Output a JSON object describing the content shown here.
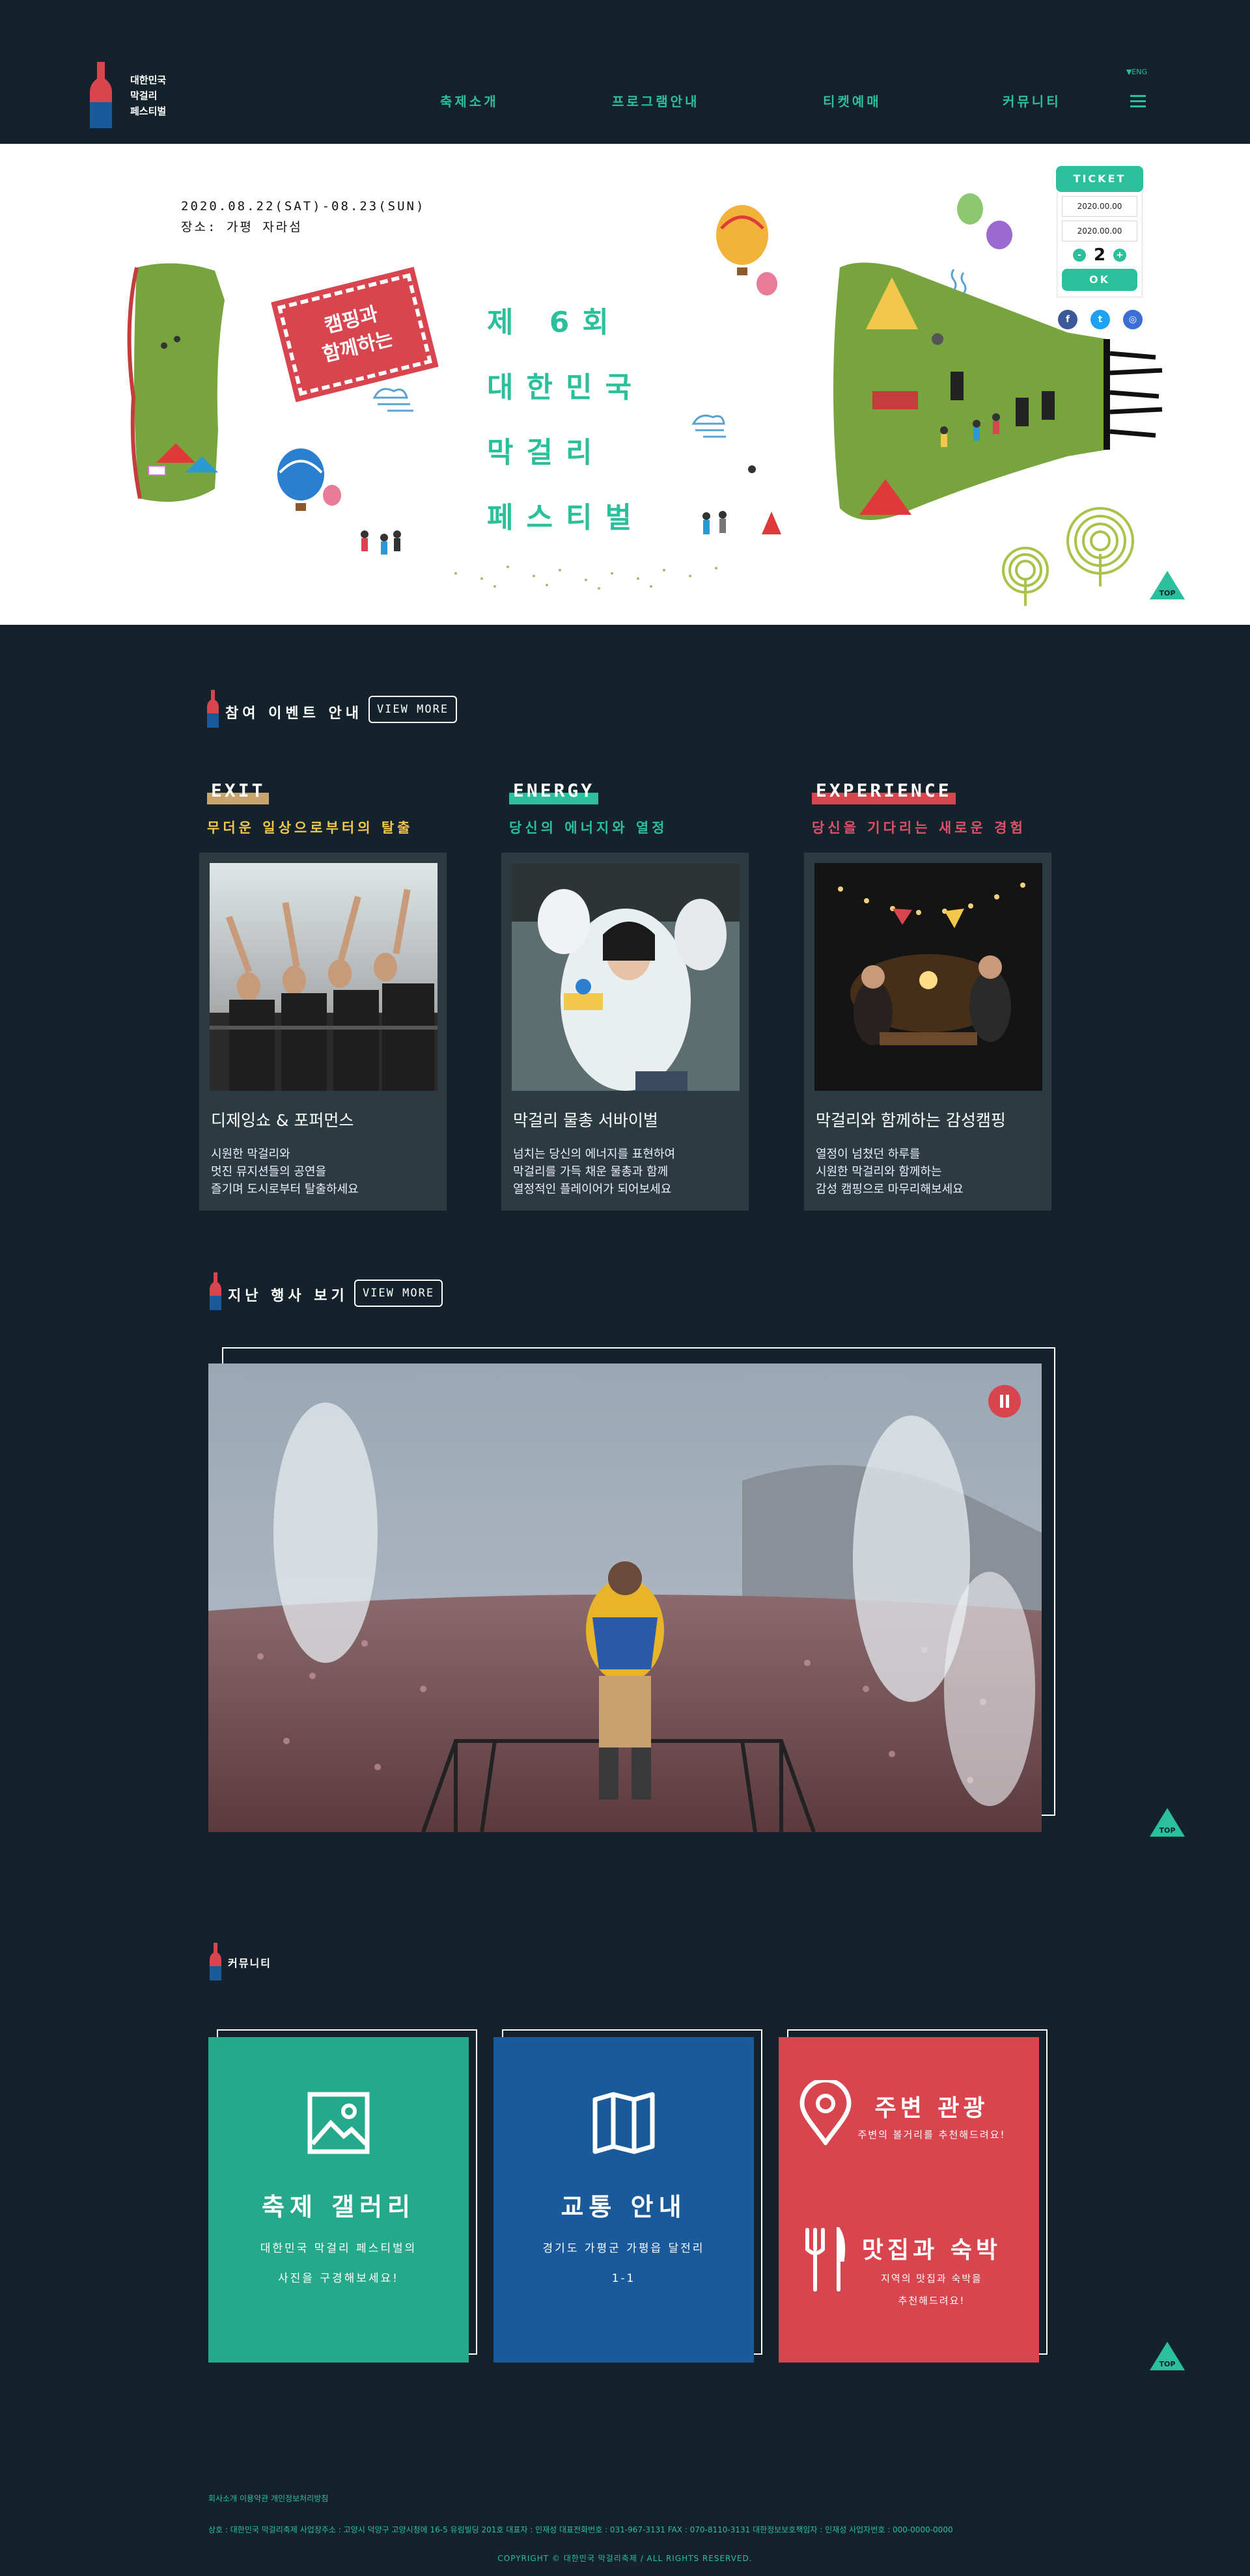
{
  "header": {
    "logo_lines": [
      "대한민국",
      "막걸리",
      "페스티벌"
    ],
    "nav": [
      "축제소개",
      "프로그램안내",
      "티켓예매",
      "커뮤니티"
    ],
    "lang": "▼ENG"
  },
  "hero": {
    "date_line": "2020.08.22(SAT)-08.23(SUN)",
    "place_line": "장소: 가평 자라섬",
    "stamp_lines": [
      "캠핑과",
      "함께하는"
    ],
    "title_lines": [
      "제 6회",
      "대한민국",
      "막걸리",
      "페스티벌"
    ],
    "ticket": {
      "head": "TICKET",
      "date_from": "2020.00.00",
      "date_to": "2020.00.00",
      "minus": "-",
      "count": "2",
      "plus": "+",
      "ok": "OK"
    },
    "social": [
      {
        "icon": "facebook-icon",
        "glyph": "f",
        "color": "#3b5998"
      },
      {
        "icon": "twitter-icon",
        "glyph": "t",
        "color": "#1da1f2"
      },
      {
        "icon": "instagram-icon",
        "glyph": "◎",
        "color": "#3b6fd6"
      }
    ],
    "top_label": "TOP"
  },
  "events": {
    "title": "참여 이벤트 안내",
    "view_more": "VIEW MORE",
    "items": [
      {
        "tag": "EXIT",
        "tag_color": "#c8a46e",
        "sub": "무더운 일상으로부터의 탈출",
        "sub_color": "#f2c84b",
        "name": "디제잉쇼 & 포퍼먼스",
        "desc": [
          "시원한 막걸리와",
          "멋진 뮤지션들의 공연을",
          "즐기며 도시로부터 탈출하세요"
        ]
      },
      {
        "tag": "ENERGY",
        "tag_color": "#2bbf9b",
        "sub": "당신의 에너지와 열정",
        "sub_color": "#2bbf9b",
        "name": "막걸리 물총 서바이벌",
        "desc": [
          "넘치는 당신의 에너지를 표현하여",
          "막걸리를 가득 채운 물총과 함께",
          "열정적인 플레이어가 되어보세요"
        ]
      },
      {
        "tag": "EXPERIENCE",
        "tag_color": "#d8454f",
        "sub": "당신을 기다리는 새로운 경험",
        "sub_color": "#e0506a",
        "name": "막걸리와 함께하는 감성캠핑",
        "desc": [
          "열정이 넘쳤던 하루를",
          "시원한 막걸리와 함께하는",
          "감성 캠핑으로 마무리해보세요"
        ]
      }
    ]
  },
  "past": {
    "title": "지난 행사 보기",
    "view_more": "VIEW MORE"
  },
  "community": {
    "title": "커뮤니티",
    "tiles": [
      {
        "title": "축제 갤러리",
        "desc": [
          "대한민국 막걸리 페스티벌의",
          "사진을 구경해보세요!"
        ],
        "color": "#25a98a"
      },
      {
        "title": "교통 안내",
        "desc": [
          "경기도 가평군 가평읍 달전리",
          "1-1"
        ],
        "color": "#1a5a9a"
      },
      {
        "title_a": "주변 관광",
        "desc_a": "주변의 볼거리를 추천해드려요!",
        "title_b": "맛집과 숙박",
        "desc_b": [
          "지역의 맛집과 숙박을",
          "추천해드려요!"
        ],
        "color": "#d8454f"
      }
    ]
  },
  "footer": {
    "links": "회사소개 이용약관 개인정보처리방침",
    "info": "상호 : 대한민국 막걸리축제      사업장주소 : 고양시 덕양구 고양시청에 16-5 유림빌딩 201호   대표자 : 인재성       대표전화번호 : 031-967-3131   FAX : 070-8110-3131       대한정보보호책임자 : 인재성   사업자번호 : 000-0000-0000",
    "copyright": "COPYRIGHT © 대한민국 막걸리축제 / ALL RIGHTS RESERVED."
  }
}
